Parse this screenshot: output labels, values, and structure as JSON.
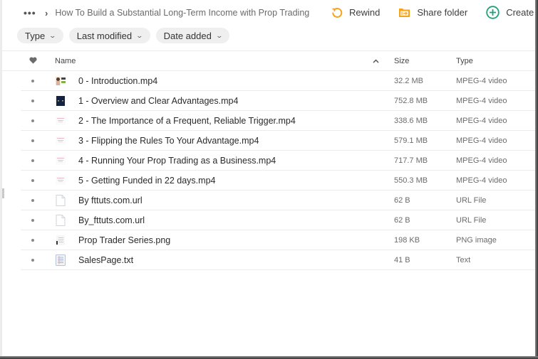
{
  "breadcrumb": {
    "more_label": "•••",
    "separator": "›",
    "title": "How To Build a Substantial Long-Term Income with Prop Trading"
  },
  "actions": [
    {
      "id": "rewind",
      "label": "Rewind",
      "icon": "rewind-icon",
      "color": "#f7a21b"
    },
    {
      "id": "share",
      "label": "Share folder",
      "icon": "share-folder-icon",
      "color": "#f7a21b"
    },
    {
      "id": "create",
      "label": "Create fol",
      "icon": "create-folder-icon",
      "color": "#1aa37a"
    }
  ],
  "filters": [
    {
      "label": "Type"
    },
    {
      "label": "Last modified"
    },
    {
      "label": "Date added"
    }
  ],
  "table": {
    "headers": {
      "favorite": "♥",
      "name": "Name",
      "sort_indicator": "^",
      "size": "Size",
      "type": "Type"
    },
    "rows": [
      {
        "name": "0 - Introduction.mp4",
        "size": "32.2 MB",
        "type": "MPEG-4 video",
        "thumb": "video-portrait"
      },
      {
        "name": "1 - Overview and Clear Advantages.mp4",
        "size": "752.8 MB",
        "type": "MPEG-4 video",
        "thumb": "video-dark"
      },
      {
        "name": "2 - The Importance of a Frequent, Reliable Trigger.mp4",
        "size": "338.6 MB",
        "type": "MPEG-4 video",
        "thumb": "video-light"
      },
      {
        "name": "3 - Flipping the Rules To Your Advantage.mp4",
        "size": "579.1 MB",
        "type": "MPEG-4 video",
        "thumb": "video-light"
      },
      {
        "name": "4 - Running Your Prop Trading as a Business.mp4",
        "size": "717.7 MB",
        "type": "MPEG-4 video",
        "thumb": "video-light"
      },
      {
        "name": "5 - Getting Funded in 22 days.mp4",
        "size": "550.3 MB",
        "type": "MPEG-4 video",
        "thumb": "video-light"
      },
      {
        "name": "By fttuts.com.url",
        "size": "62 B",
        "type": "URL File",
        "thumb": "file"
      },
      {
        "name": "By_fttuts.com.url",
        "size": "62 B",
        "type": "URL File",
        "thumb": "file"
      },
      {
        "name": "Prop Trader Series.png",
        "size": "198 KB",
        "type": "PNG image",
        "thumb": "image"
      },
      {
        "name": "SalesPage.txt",
        "size": "41 B",
        "type": "Text",
        "thumb": "text"
      }
    ]
  }
}
